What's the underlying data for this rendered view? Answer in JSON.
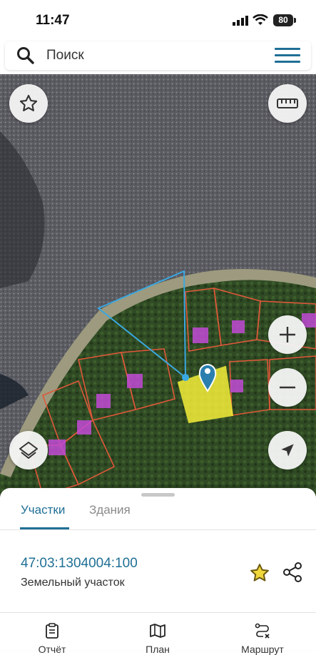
{
  "status": {
    "time": "11:47",
    "battery": "80"
  },
  "search": {
    "placeholder": "Поиск"
  },
  "map": {
    "controls": [
      "star-icon",
      "ruler-icon",
      "zoom-in-icon",
      "zoom-out-icon",
      "layers-icon",
      "location-arrow-icon"
    ]
  },
  "sheet": {
    "tabs": [
      {
        "label": "Участки",
        "active": true
      },
      {
        "label": "Здания",
        "active": false
      }
    ],
    "parcel": {
      "cadastral_number": "47:03:1304004:100",
      "type": "Земельный участок"
    }
  },
  "bottom_nav": [
    {
      "label": "Отчёт",
      "icon": "report-icon"
    },
    {
      "label": "План",
      "icon": "map-icon"
    },
    {
      "label": "Маршрут",
      "icon": "route-icon"
    }
  ],
  "colors": {
    "accent": "#1f6f95",
    "parcel_highlight": "#f5ef3a",
    "boundary": "#e0583a",
    "building": "#c24bd6"
  }
}
